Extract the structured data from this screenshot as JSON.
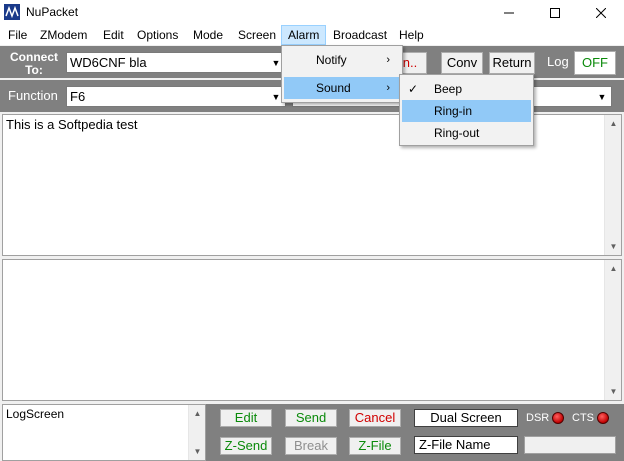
{
  "window": {
    "title": "NuPacket"
  },
  "menubar": {
    "items": [
      "File",
      "ZModem",
      "Edit",
      "Options",
      "Mode",
      "Screen",
      "Alarm",
      "Broadcast",
      "Help"
    ]
  },
  "connect": {
    "label": "Connect To:",
    "value": "WD6CNF bla"
  },
  "function_row": {
    "label": "Function",
    "value": "F6"
  },
  "buttons": {
    "conn_partial": "n..",
    "conv": "Conv",
    "return": "Return",
    "log": "Log",
    "off": "OFF"
  },
  "panes": {
    "top_text": "This is a Softpedia test",
    "logscreen": "LogScreen"
  },
  "bottom": {
    "edit": "Edit",
    "send": "Send",
    "cancel": "Cancel",
    "dual_screen": "Dual Screen",
    "dsr": "DSR",
    "cts": "CTS",
    "zsend": "Z-Send",
    "break": "Break",
    "zfile": "Z-File",
    "zfile_name": "Z-File Name"
  },
  "alarm_menu": {
    "notify": "Notify",
    "sound": "Sound"
  },
  "sound_menu": {
    "beep": "Beep",
    "ringin": "Ring-in",
    "ringout": "Ring-out"
  },
  "colors": {
    "accent_green": "#0a8a0a",
    "cancel_red": "#d00000",
    "menu_highlight": "#91c9f7"
  }
}
